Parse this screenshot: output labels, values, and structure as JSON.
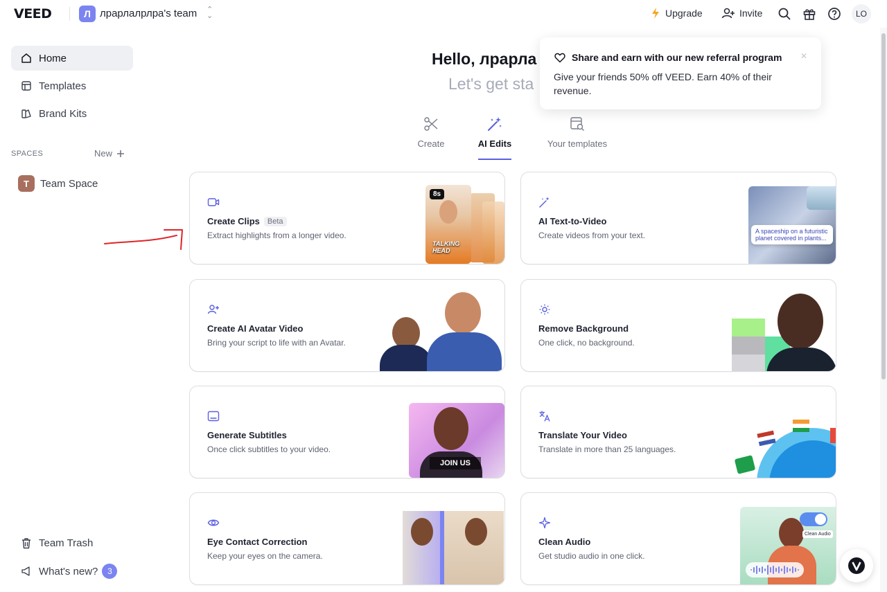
{
  "topbar": {
    "logo": "VEED",
    "team_initial": "Л",
    "team_name": "лрарлалрлра's team",
    "upgrade_label": "Upgrade",
    "invite_label": "Invite",
    "user_initials": "LO",
    "icons": [
      "lightning-icon",
      "add-user-icon",
      "search-icon",
      "gift-icon",
      "help-icon"
    ]
  },
  "sidebar": {
    "items": [
      {
        "label": "Home",
        "icon": "home-icon",
        "active": true
      },
      {
        "label": "Templates",
        "icon": "templates-icon"
      },
      {
        "label": "Brand Kits",
        "icon": "brand-kit-icon"
      }
    ],
    "spaces_label": "SPACES",
    "new_label": "New",
    "space": {
      "initial": "T",
      "label": "Team Space"
    },
    "trash_label": "Team Trash",
    "whats_new_label": "What's new?",
    "whats_new_count": "3"
  },
  "main": {
    "hello": "Hello, лрарла",
    "subtitle": "Let's get sta",
    "tabs": [
      {
        "label": "Create",
        "icon": "scissors-icon"
      },
      {
        "label": "AI Edits",
        "icon": "magic-wand-icon",
        "active": true
      },
      {
        "label": "Your templates",
        "icon": "template-search-icon"
      }
    ],
    "cards": [
      {
        "title": "Create Clips",
        "badge": "Beta",
        "desc": "Extract highlights from a longer video.",
        "icon": "video-camera-icon",
        "thumb_badge": "8s",
        "thumb_caption": "TALKING HEAD"
      },
      {
        "title": "AI Text-to-Video",
        "desc": "Create videos from your text.",
        "icon": "magic-wand-icon",
        "thumb_caption": "A spaceship on a futuristic planet covered in plants..."
      },
      {
        "title": "Create AI Avatar Video",
        "desc": "Bring your script to life with an Avatar.",
        "icon": "avatar-add-icon"
      },
      {
        "title": "Remove Background",
        "desc": "One click, no background.",
        "icon": "remove-bg-icon"
      },
      {
        "title": "Generate Subtitles",
        "desc": "Once click subtitles to your video.",
        "icon": "subtitles-icon",
        "thumb_caption": "JOIN US"
      },
      {
        "title": "Translate Your Video",
        "desc": "Translate in more than 25 languages.",
        "icon": "translate-icon"
      },
      {
        "title": "Eye Contact Correction",
        "desc": "Keep your eyes on the camera.",
        "icon": "eye-icon"
      },
      {
        "title": "Clean Audio",
        "desc": "Get studio audio in one click.",
        "icon": "sparkle-icon",
        "thumb_caption": "Clean Audio"
      }
    ]
  },
  "notification": {
    "title": "Share and earn with our new referral program",
    "body": "Give your friends 50% off VEED. Earn 40% of their revenue.",
    "icon": "heart-icon"
  },
  "colors": {
    "accent": "#5a5fe0",
    "team_avatar": "#7b84f0",
    "space_avatar": "#a86f5e",
    "annotation_arrow": "#e0242a"
  }
}
